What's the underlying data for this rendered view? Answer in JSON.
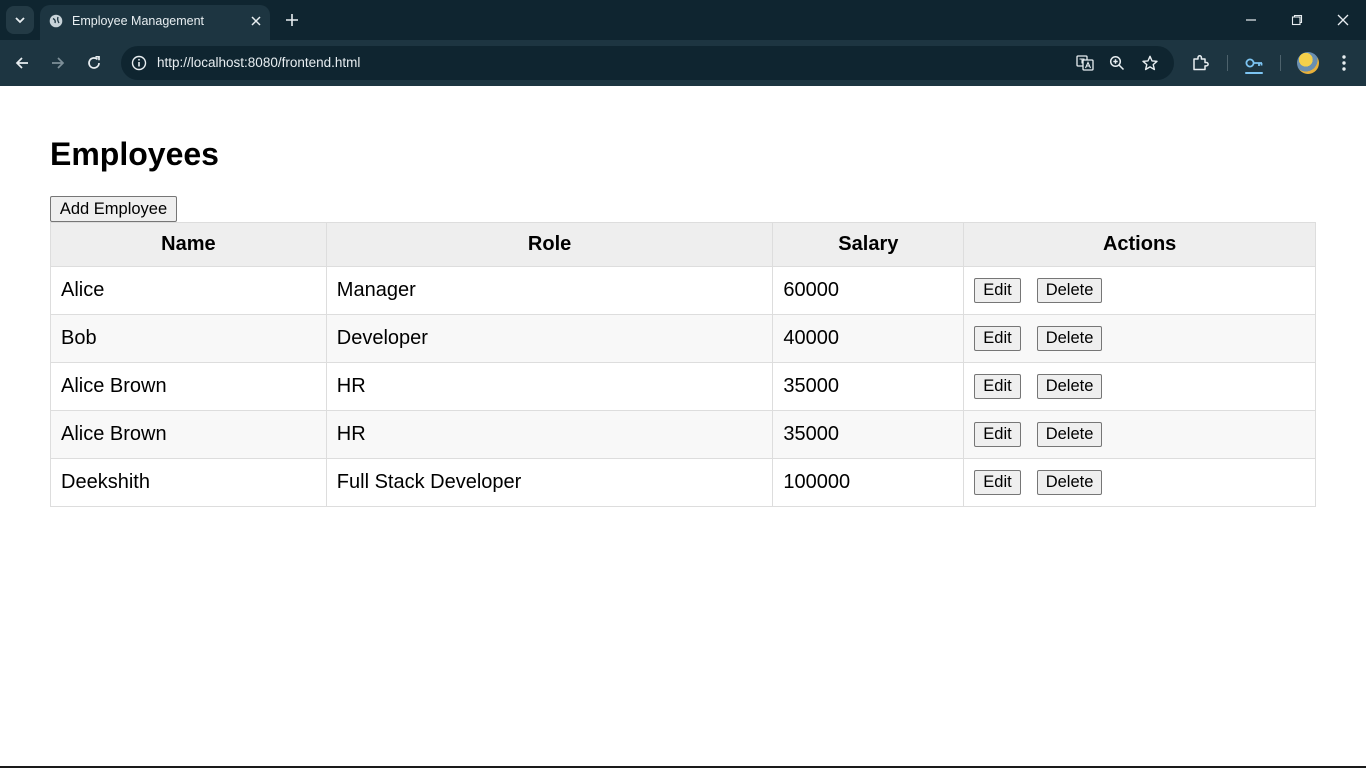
{
  "browser": {
    "tab_title": "Employee Management",
    "url": "http://localhost:8080/frontend.html"
  },
  "page": {
    "title": "Employees",
    "add_button_label": "Add Employee"
  },
  "table": {
    "headers": {
      "name": "Name",
      "role": "Role",
      "salary": "Salary",
      "actions": "Actions"
    },
    "rows": [
      {
        "name": "Alice",
        "role": "Manager",
        "salary": "60000"
      },
      {
        "name": "Bob",
        "role": "Developer",
        "salary": "40000"
      },
      {
        "name": "Alice Brown",
        "role": "HR",
        "salary": "35000"
      },
      {
        "name": "Alice Brown",
        "role": "HR",
        "salary": "35000"
      },
      {
        "name": "Deekshith",
        "role": "Full Stack Developer",
        "salary": "100000"
      }
    ],
    "edit_label": "Edit",
    "delete_label": "Delete"
  },
  "icons": {
    "tab_search": "chevron-down-icon",
    "favicon": "globe-icon",
    "tab_close": "close-icon",
    "new_tab": "plus-icon",
    "back": "back-arrow-icon",
    "forward": "forward-arrow-icon",
    "reload": "reload-icon",
    "site_info": "info-icon",
    "translate": "translate-icon",
    "zoom": "zoom-icon",
    "bookmark": "star-icon",
    "extensions": "puzzle-icon",
    "passwords": "key-icon",
    "menu": "kebab-menu-icon"
  },
  "colors": {
    "chrome_dark": "#0f2530",
    "chrome_toolbar": "#1d3541",
    "table_header_bg": "#eeeeee",
    "table_border": "#dddddd",
    "row_stripe": "#f8f8f8"
  }
}
